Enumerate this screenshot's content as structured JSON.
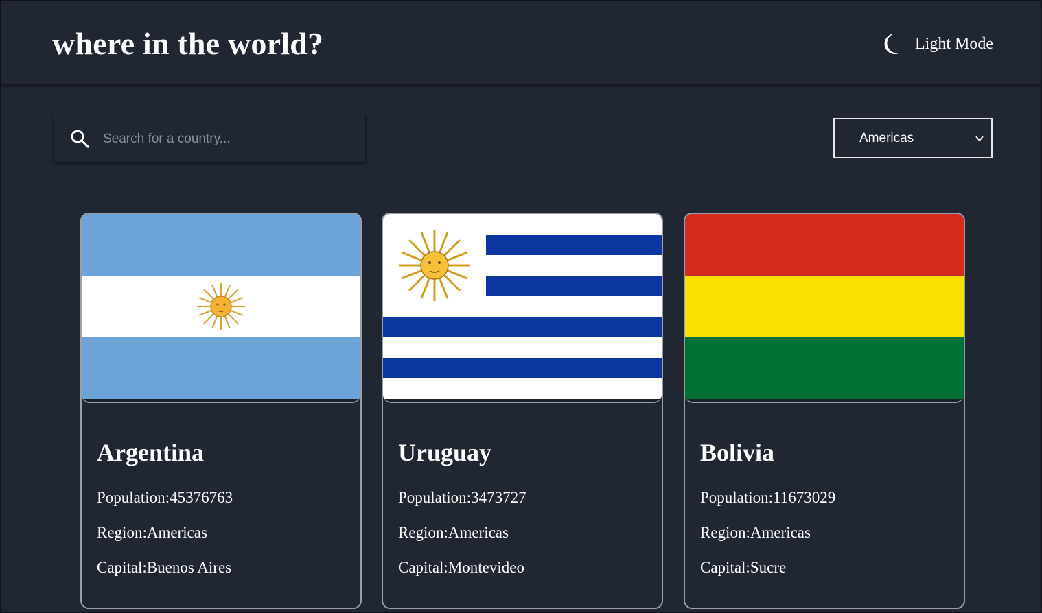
{
  "header": {
    "title": "where in the world?",
    "mode_label": "Light Mode",
    "mode_icon": "moon-icon"
  },
  "search": {
    "placeholder": "Search for a country...",
    "value": ""
  },
  "filter": {
    "selected": "Americas"
  },
  "labels": {
    "population": "Population:",
    "region": "Region:",
    "capital": "Capital:"
  },
  "countries": [
    {
      "name": "Argentina",
      "population": "45376763",
      "region": "Americas",
      "capital": "Buenos Aires"
    },
    {
      "name": "Uruguay",
      "population": "3473727",
      "region": "Americas",
      "capital": "Montevideo"
    },
    {
      "name": "Bolivia",
      "population": "11673029",
      "region": "Americas",
      "capital": "Sucre"
    }
  ],
  "colors": {
    "background": "#202632",
    "header": "#212732",
    "text": "#ffffff",
    "card_border": "#9aa0a6"
  }
}
